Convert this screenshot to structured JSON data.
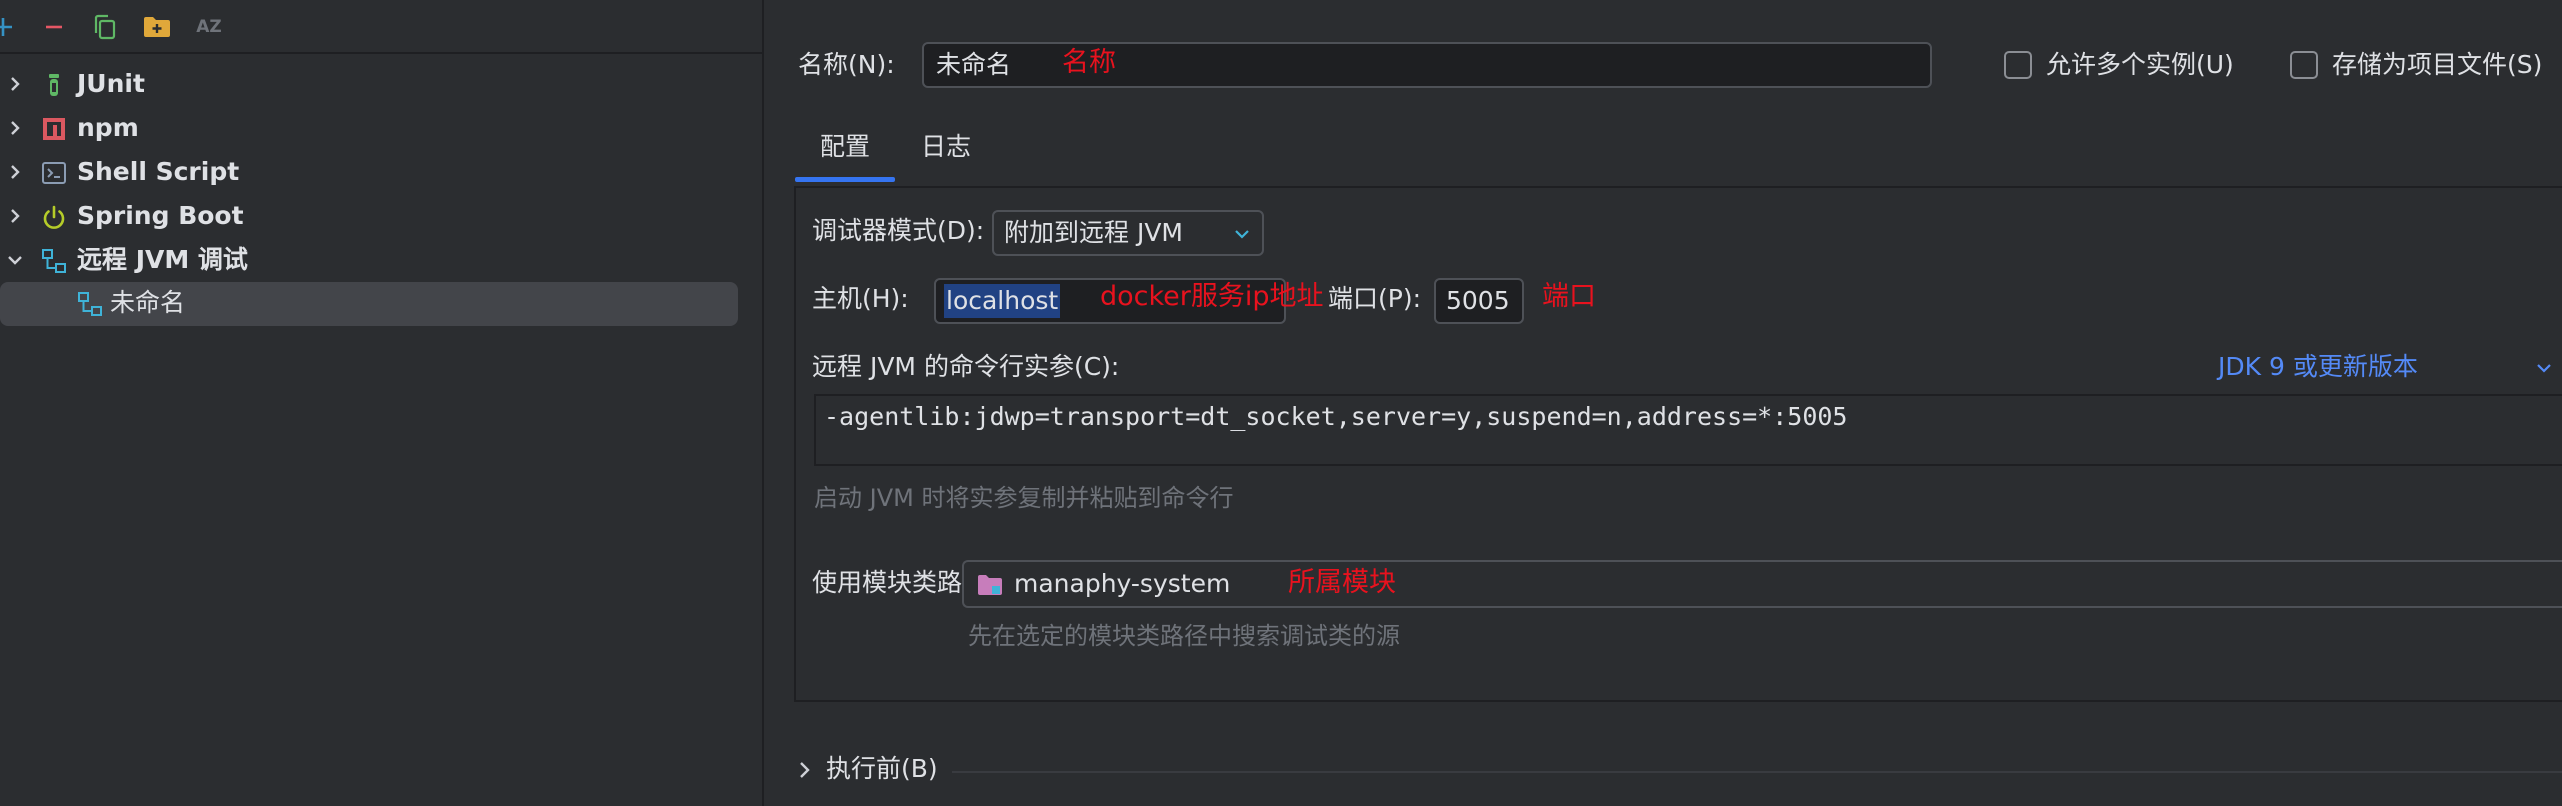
{
  "toolbar": {
    "items": [
      "add-icon",
      "remove-icon",
      "copy-icon",
      "folder-add-icon",
      "sort-az-icon"
    ],
    "sort_label": "AZ"
  },
  "tree": {
    "items": [
      {
        "label": "JUnit",
        "icon": "junit-icon",
        "expanded": false
      },
      {
        "label": "npm",
        "icon": "npm-icon",
        "expanded": false
      },
      {
        "label": "Shell Script",
        "icon": "shell-script-icon",
        "expanded": false
      },
      {
        "label": "Spring Boot",
        "icon": "spring-boot-icon",
        "expanded": false
      },
      {
        "label": "远程 JVM 调试",
        "icon": "remote-jvm-icon",
        "expanded": true
      }
    ],
    "child": {
      "label": "未命名",
      "icon": "remote-jvm-icon",
      "selected": true
    }
  },
  "form": {
    "name_label": "名称(N):",
    "name_value": "未命名",
    "name_annotation": "名称",
    "allow_multiple_label": "允许多个实例(U)",
    "store_project_label": "存储为项目文件(S)",
    "tabs": [
      {
        "label": "配置",
        "active": true
      },
      {
        "label": "日志",
        "active": false
      }
    ],
    "debugger_mode_label": "调试器模式(D):",
    "debugger_mode_value": "附加到远程 JVM",
    "host_label": "主机(H):",
    "host_value": "localhost",
    "host_annotation": "docker服务ip地址",
    "port_label": "端口(P):",
    "port_value": "5005",
    "port_annotation": "端口",
    "cmdline_label": "远程 JVM 的命令行实参(C):",
    "jdk_link": "JDK 9 或更新版本",
    "cmdline_value": "-agentlib:jdwp=transport=dt_socket,server=y,suspend=n,address=*:5005",
    "cmdline_hint": "启动 JVM 时将实参复制并粘贴到命令行",
    "module_label": "使用模块类路径(M):",
    "module_value": "manaphy-system",
    "module_annotation": "所属模块",
    "module_hint": "先在选定的模块类路径中搜索调试类的源",
    "before_launch_label": "执行前(B)"
  },
  "colors": {
    "background": "#2b2d30",
    "accent": "#3574f0",
    "link": "#548af7",
    "annotation": "#e8121e",
    "input_bg": "#1e1f22"
  }
}
